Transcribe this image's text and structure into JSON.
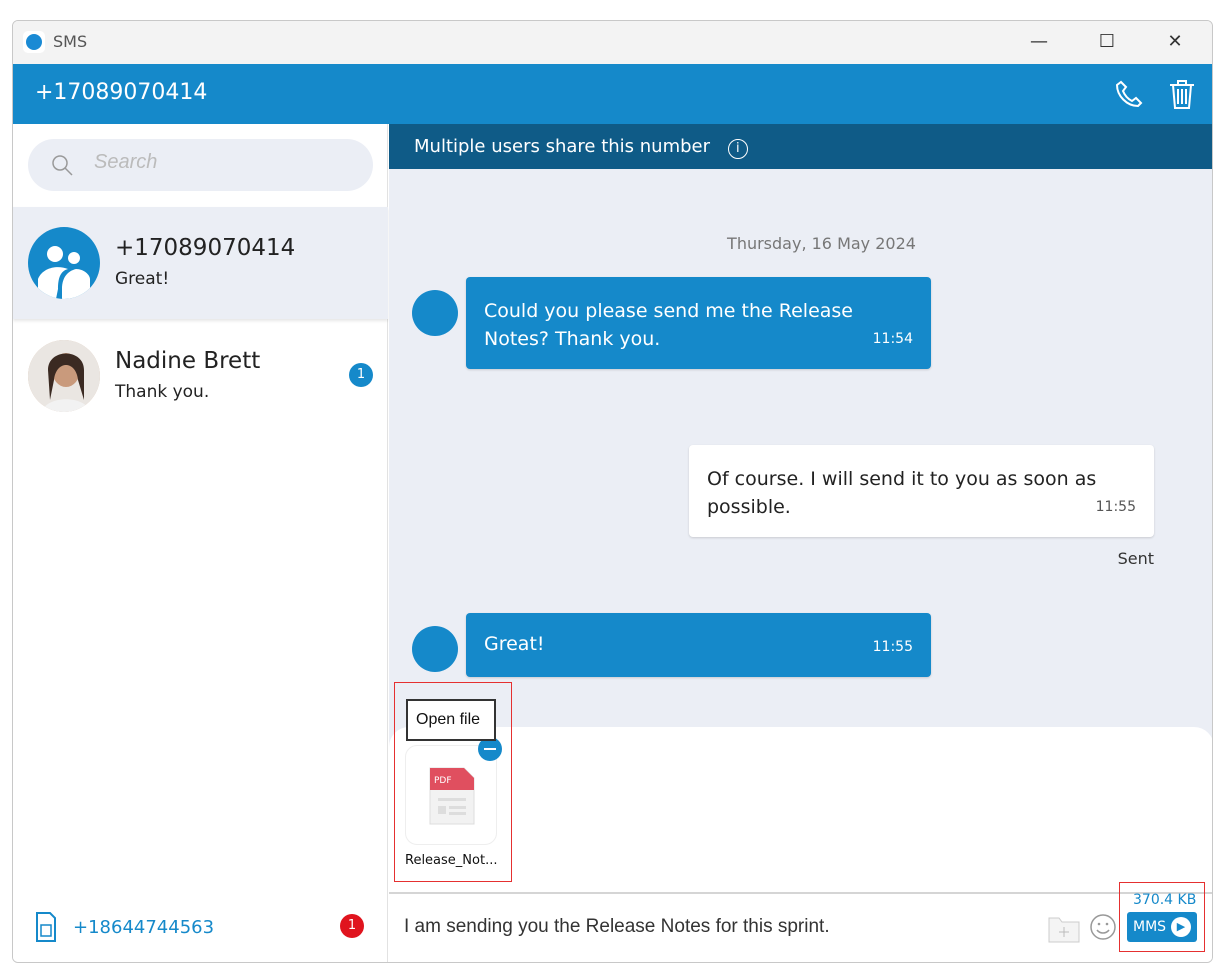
{
  "window": {
    "title": "SMS",
    "controls": [
      "minimize",
      "maximize",
      "close"
    ]
  },
  "header": {
    "number": "+17089070414"
  },
  "search": {
    "placeholder": "Search"
  },
  "conversations": [
    {
      "name": "+17089070414",
      "preview": "Great!",
      "active": true,
      "avatar": "group-icon"
    },
    {
      "name": "Nadine Brett",
      "preview": "Thank you.",
      "unread": "1",
      "avatar": "photo"
    }
  ],
  "footer": {
    "number": "+18644744563",
    "badge": "1",
    "badge_color": "#e0141e"
  },
  "banner": {
    "text": "Multiple users share this number"
  },
  "chat": {
    "date": "Thursday, 16 May 2024",
    "messages": [
      {
        "dir": "in",
        "text": "Could you please send me the Release Notes? Thank you.",
        "time": "11:54"
      },
      {
        "dir": "out",
        "text": "Of course. I will send it to you as soon as possible.",
        "time": "11:55",
        "status": "Sent"
      },
      {
        "dir": "in",
        "text": "Great!",
        "time": "11:55"
      }
    ]
  },
  "attachment": {
    "tooltip": "Open file",
    "filename": "Release_Not...",
    "type": "PDF"
  },
  "compose": {
    "text": "I am sending you the Release Notes for this sprint.",
    "size": "370.4 KB",
    "send_label": "MMS"
  },
  "colors": {
    "accent": "#1589ca",
    "banner": "#0f5b87",
    "background": "#ebeef5"
  }
}
